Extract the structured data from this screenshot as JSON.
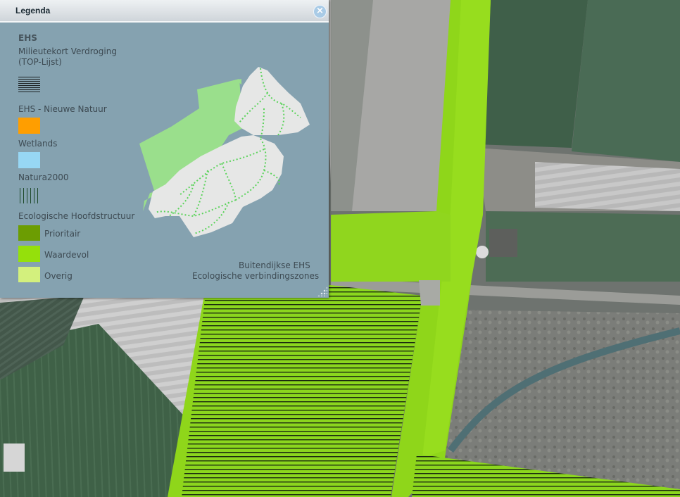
{
  "legend": {
    "title": "Legenda",
    "close_label": "×",
    "group_ehs": {
      "title": "EHS",
      "milieu_line1": "Milieutekort Verdroging",
      "milieu_line2": "(TOP-Lijst)",
      "nieuwe_natuur": "EHS - Nieuwe Natuur",
      "wetlands": "Wetlands",
      "natura2000": "Natura2000"
    },
    "group_eco": {
      "title": "Ecologische Hoofdstructuur",
      "items": [
        {
          "label": "Prioritair",
          "color": "#6c9d02"
        },
        {
          "label": "Waardevol",
          "color": "#95e00b"
        },
        {
          "label": "Overig",
          "color": "#d3f07d"
        }
      ]
    },
    "colors": {
      "nieuwe_natuur": "#ff9e00",
      "wetlands": "#97d7f4",
      "hatch": "#1d2224",
      "natura_hatch": "#1f4b2c"
    },
    "inset": {
      "label_buitendijks": "Buitendijkse EHS",
      "label_verbinding": "Ecologische verbindingszones",
      "land_color": "#e6e7e6",
      "outer_color": "#9adf8c",
      "route_color": "#5bd35b"
    }
  }
}
